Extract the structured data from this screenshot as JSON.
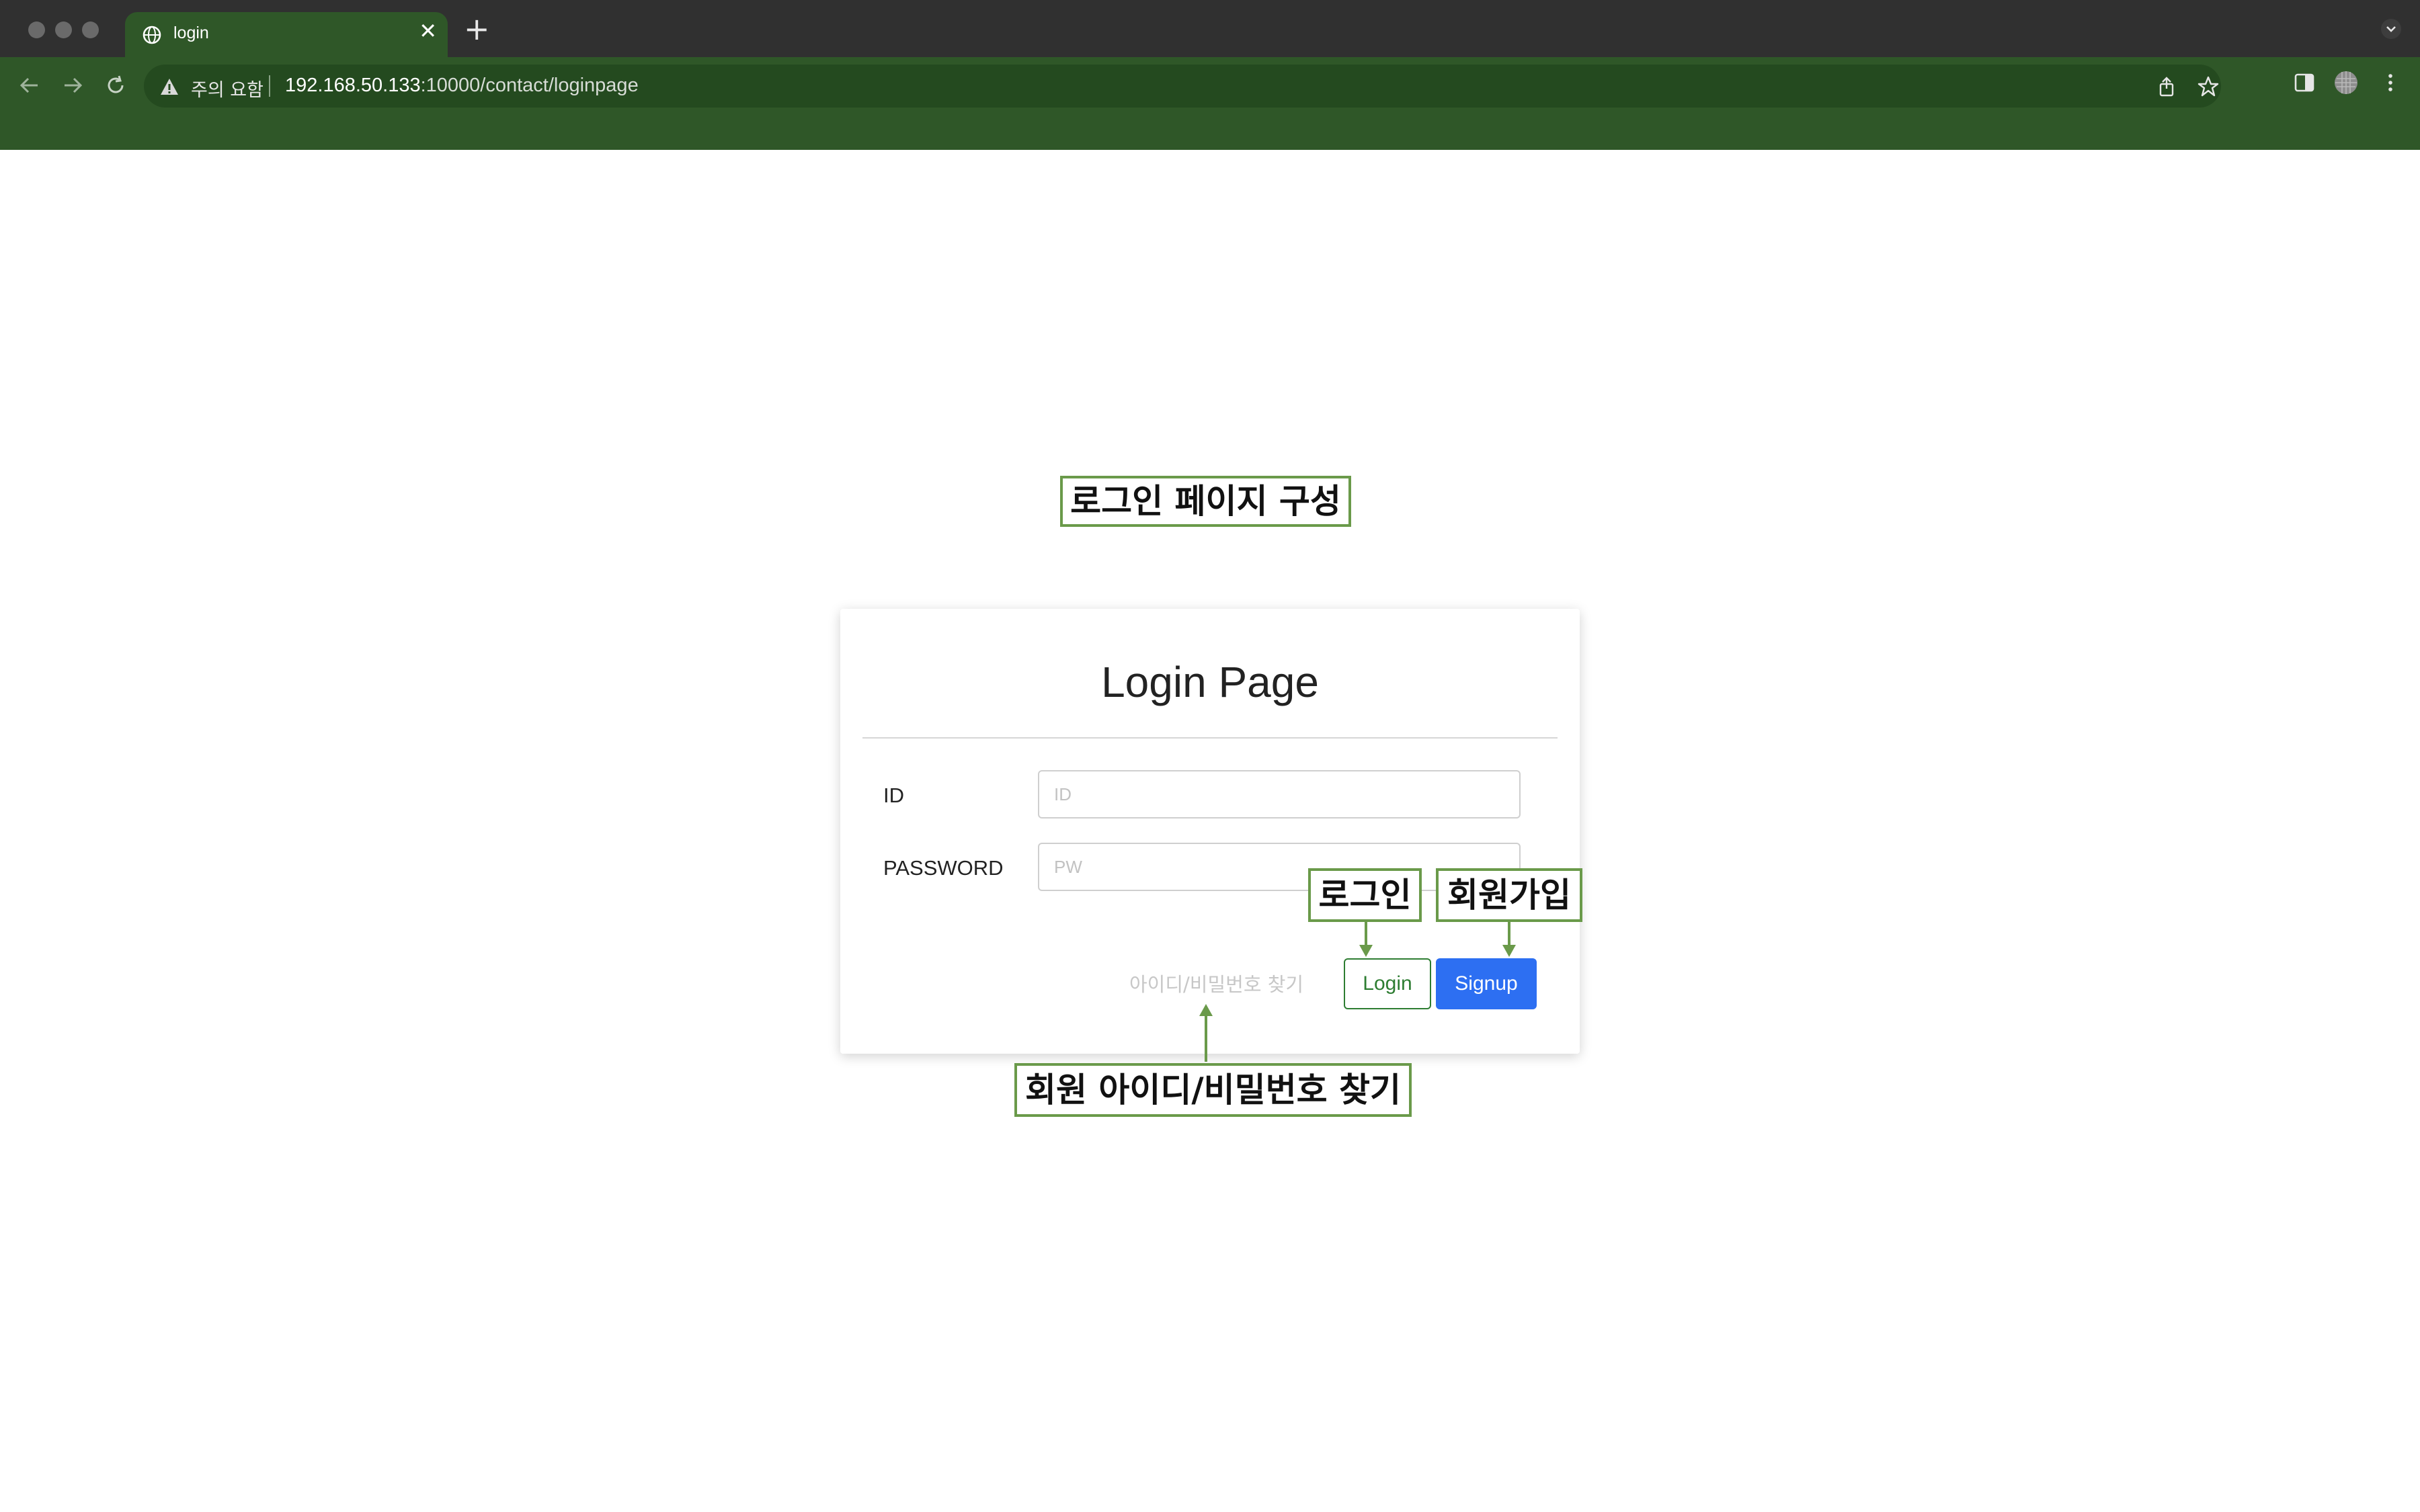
{
  "browser": {
    "tab": {
      "title": "login",
      "close_glyph": "✕"
    },
    "new_tab_glyph": "+",
    "security_warning": "주의 요함",
    "url": {
      "host": "192.168.50.133",
      "rest": ":10000/contact/loginpage"
    },
    "icons": [
      "back-icon",
      "forward-icon",
      "reload-icon",
      "warning-icon",
      "share-icon",
      "star-icon",
      "side-panel-icon",
      "profile-icon",
      "menu-icon",
      "globe-icon",
      "chevron-down-icon"
    ],
    "theme_color": "#2f5728"
  },
  "annotations": {
    "header": "로그인 페이지 구성",
    "login": "로그인",
    "signup": "회원가입",
    "find": "회원 아이디/비밀번호 찾기"
  },
  "login_card": {
    "title": "Login Page",
    "id_label": "ID",
    "id_placeholder": "ID",
    "password_label": "PASSWORD",
    "password_placeholder": "PW",
    "find_link": "아이디/비밀번호 찾기",
    "login_button": "Login",
    "signup_button": "Signup"
  },
  "colors": {
    "annotation_border": "#6a9a4a",
    "signup_button": "#2d6ff2",
    "login_button_outline": "#2e7d32"
  }
}
